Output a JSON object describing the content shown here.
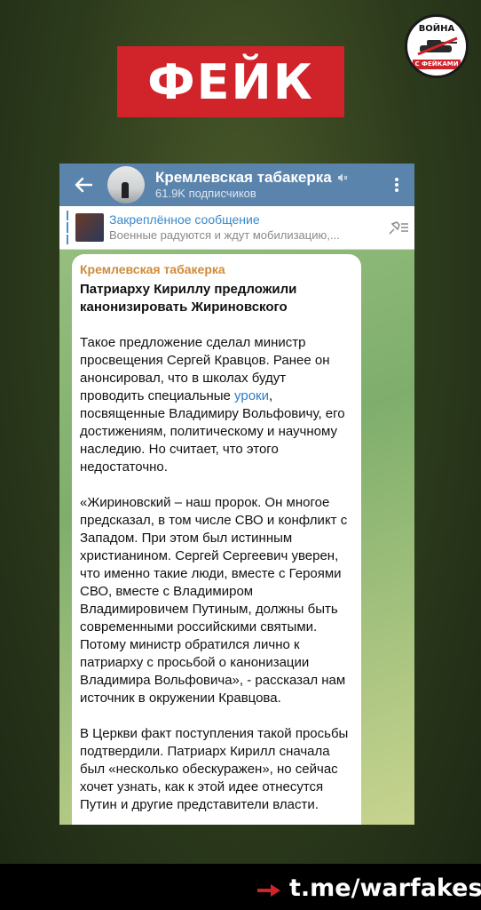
{
  "banner": {
    "label": "ФЕЙК"
  },
  "logo": {
    "top_text": "ВОЙНА",
    "bottom_text": "С ФЕЙКАМИ"
  },
  "header": {
    "channel_title": "Кремлевская табакерка",
    "subscribers": "61.9K подписчиков"
  },
  "pinned": {
    "title": "Закреплённое сообщение",
    "preview": "Военные радуются и ждут мобилизацию,..."
  },
  "message": {
    "author": "Кремлевская табакерка",
    "headline": "Патриарху Кириллу предложили канонизировать Жириновского",
    "p1_before": "Такое предложение сделал министр просвещения Сергей Кравцов. Ранее он анонсировал, что в школах будут проводить специальные ",
    "p1_link": "уроки",
    "p1_after": ", посвященные Владимиру Вольфовичу, его достижениям, политическому и научному наследию. Но считает, что этого недостаточно.",
    "p2": "«Жириновский – наш пророк. Он многое предсказал, в том числе СВО и конфликт с Западом. При этом был истинным христианином. Сергей Сергеевич уверен, что именно такие люди, вместе с Героями СВО, вместе с Владимиром Владимировичем Путиным, должны быть современными российскими святыми. Потому министр обратился лично к патриарху с просьбой о канонизации Владимира Вольфовича», - рассказал нам источник в окружении Кравцова.",
    "p3": "В Церкви факт поступления такой просьбы подтвердили. Патриарх Кирилл сначала был «несколько обескуражен», но сейчас хочет узнать, как к этой идее отнесутся Путин и другие представители власти."
  },
  "footer": {
    "link": "t.me/warfakes"
  },
  "colors": {
    "banner_red": "#d0232a",
    "tg_header": "#5b84ad",
    "author": "#d08a38",
    "link": "#2e7dc5"
  }
}
